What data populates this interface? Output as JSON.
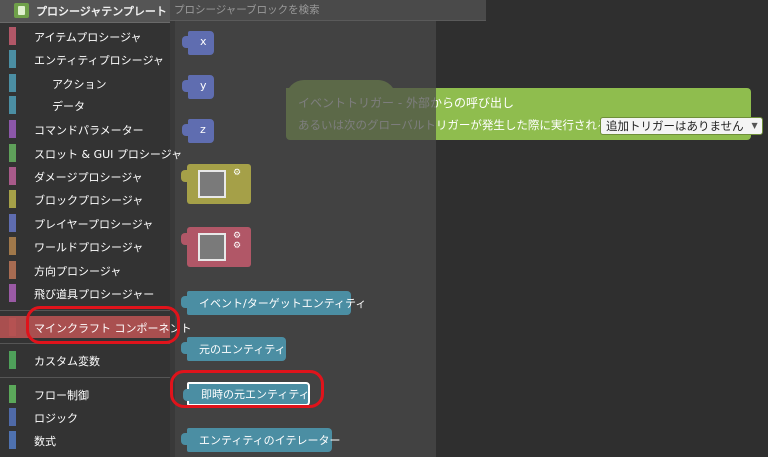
{
  "toolbox": {
    "title": "プロシージャテンプレート",
    "categories": [
      {
        "label": "アイテムプロシージャ",
        "color": "#b15767"
      },
      {
        "label": "エンティティプロシージャ",
        "color": "#4b8ea3"
      },
      {
        "label": "アクション",
        "color": "#4b8ea3"
      },
      {
        "label": "データ",
        "color": "#4b8ea3"
      },
      {
        "label": "コマンドパラメーター",
        "color": "#8c57a9"
      },
      {
        "label": "スロット & GUI プロシージャ",
        "color": "#5fa05a"
      },
      {
        "label": "ダメージプロシージャ",
        "color": "#a85a8a"
      },
      {
        "label": "ブロックプロシージャ",
        "color": "#a5a048"
      },
      {
        "label": "プレイヤープロシージャ",
        "color": "#5f6db0"
      },
      {
        "label": "ワールドプロシージャ",
        "color": "#a0784a"
      },
      {
        "label": "方向プロシージャ",
        "color": "#a86c52"
      },
      {
        "label": "飛び道具プロシージャー",
        "color": "#9a5aa5"
      },
      {
        "label": "マインクラフト コンポーネント",
        "color": "#b55252"
      },
      {
        "label": "カスタム変数",
        "color": "#4fa05a"
      },
      {
        "label": "フロー制御",
        "color": "#5ba85a"
      },
      {
        "label": "ロジック",
        "color": "#4f6aa8"
      },
      {
        "label": "数式",
        "color": "#4f72b0"
      }
    ]
  },
  "search": {
    "placeholder": "プロシージャーブロックを検索"
  },
  "event_block": {
    "line1": "イベントトリガー - 外部からの呼び出し",
    "line2": "あるいは次のグローバルトリガーが発生した際に実行される:",
    "dropdown": "追加トリガーはありません",
    "color": "#8fbd4e"
  },
  "flyout": {
    "blocks": [
      {
        "label": "x",
        "color": "#5f6db0"
      },
      {
        "label": "y",
        "color": "#5f6db0"
      },
      {
        "label": "z",
        "color": "#5f6db0"
      },
      {
        "label": "イベント/ターゲットエンティティ",
        "color": "#4b8ea3"
      },
      {
        "label": "元のエンティティ",
        "color": "#4b8ea3"
      },
      {
        "label": "即時の元エンティティ",
        "color": "#4b8ea3"
      },
      {
        "label": "エンティティのイテレーター",
        "color": "#4b8ea3"
      }
    ],
    "item_block_color": "#a5a048",
    "damage_block_color": "#b15767"
  },
  "icons": {
    "header": "procedure-template-icon",
    "gear": "gear-icon"
  }
}
